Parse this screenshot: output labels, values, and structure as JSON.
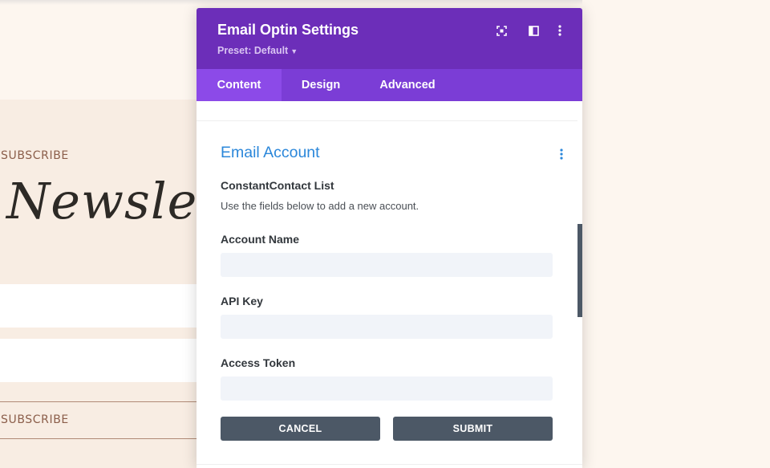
{
  "background": {
    "label_top": "SUBSCRIBE",
    "heading": "Newsletter",
    "label_bottom": "SUBSCRIBE"
  },
  "modal": {
    "title": "Email Optin Settings",
    "preset": "Preset: Default",
    "header_icons": [
      "expand-icon",
      "split-view-icon",
      "more-vertical-icon"
    ],
    "tabs": [
      {
        "label": "Content",
        "active": true
      },
      {
        "label": "Design",
        "active": false
      },
      {
        "label": "Advanced",
        "active": false
      }
    ]
  },
  "email_account": {
    "section_title": "Email Account",
    "list_label": "ConstantContact List",
    "help_text": "Use the fields below to add a new account.",
    "fields": [
      {
        "label": "Account Name",
        "value": "",
        "placeholder": ""
      },
      {
        "label": "API Key",
        "value": "",
        "placeholder": ""
      },
      {
        "label": "Access Token",
        "value": "",
        "placeholder": ""
      }
    ],
    "cancel_label": "CANCEL",
    "submit_label": "SUBMIT"
  },
  "colors": {
    "header_purple": "#6c2eb9",
    "tab_bar_purple": "#7b3dd6",
    "active_tab": "#8c4ae8",
    "section_blue": "#2b87da",
    "button_gray": "#4c5866"
  }
}
